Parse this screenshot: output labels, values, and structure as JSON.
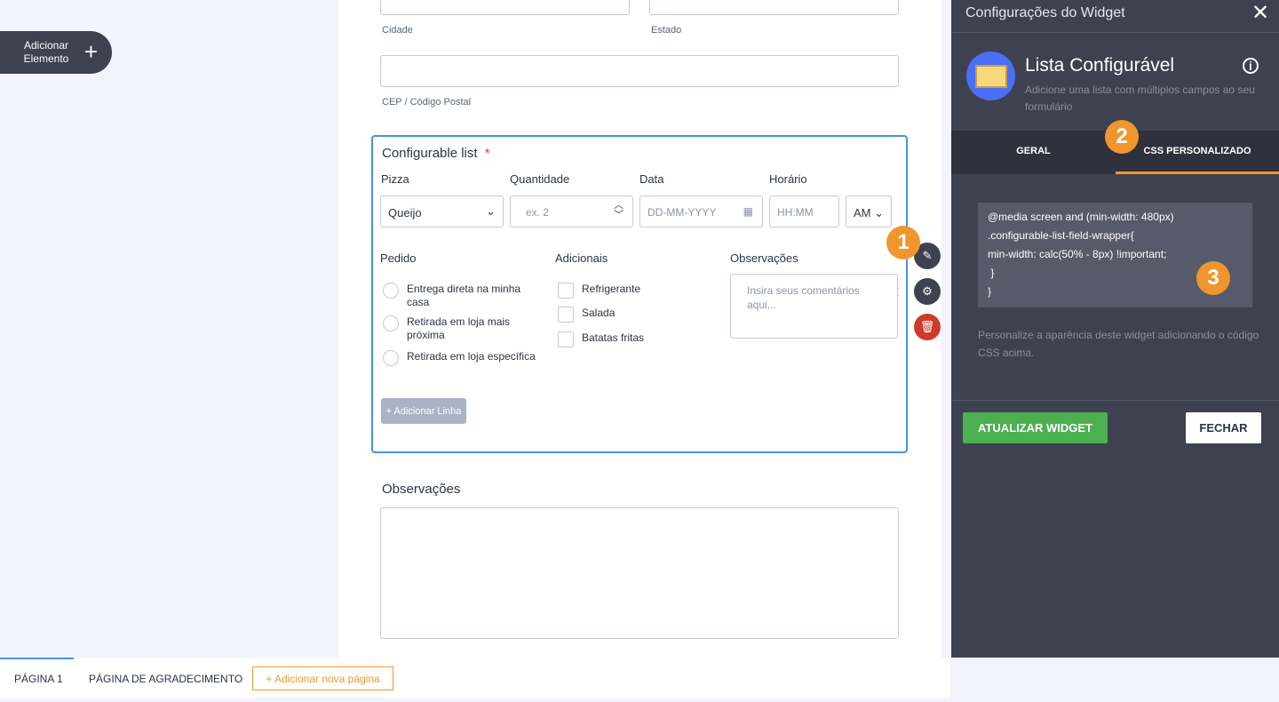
{
  "sidebar": {
    "add_element": "Adicionar Elemento"
  },
  "form": {
    "city_label": "Cidade",
    "state_label": "Estado",
    "zip_label": "CEP / Código Postal",
    "list": {
      "title": "Configurable list",
      "required": "*",
      "columns": {
        "pizza": "Pizza",
        "quantity": "Quantidade",
        "date": "Data",
        "time": "Horário"
      },
      "pizza_value": "Queijo",
      "quantity_placeholder": "ex. 2",
      "date_placeholder": "DD-MM-YYYY",
      "time_placeholder": "HH:MM",
      "ampm_value": "AM",
      "order_label": "Pedido",
      "order_options": [
        "Entrega direta na minha casa",
        "Retirada em loja mais próxima",
        "Retirada em loja específica"
      ],
      "extras_label": "Adicionais",
      "extras_options": [
        "Refrigerante",
        "Salada",
        "Batatas fritas"
      ],
      "notes_label": "Observações",
      "notes_placeholder": "Insira seus comentários aqui...",
      "add_row": "+ Adicionar Linha"
    },
    "observations_label": "Observações"
  },
  "badges": [
    "1",
    "2",
    "3"
  ],
  "panel": {
    "title": "Configurações do Widget",
    "widget_name": "Lista Configurável",
    "widget_desc": "Adicione uma lista com múltiplos campos ao seu formulário",
    "tabs": [
      "GERAL",
      "CSS PERSONALIZADO"
    ],
    "css_code": "@media screen and (min-width: 480px)\n.configurable-list-field-wrapper{\nmin-width: calc(50% - 8px) !important;\n }\n}",
    "help": "Personalize a aparência deste widget adicionando o código CSS acima.",
    "update_button": "ATUALIZAR WIDGET",
    "close_button": "FECHAR",
    "colors": {
      "accent": "#f0962e",
      "update": "#4caf50",
      "delete": "#d03a2b"
    }
  },
  "pages": {
    "page1": "PÁGINA 1",
    "thanks": "PÁGINA DE AGRADECIMENTO",
    "add": "+ Adicionar nova página"
  }
}
